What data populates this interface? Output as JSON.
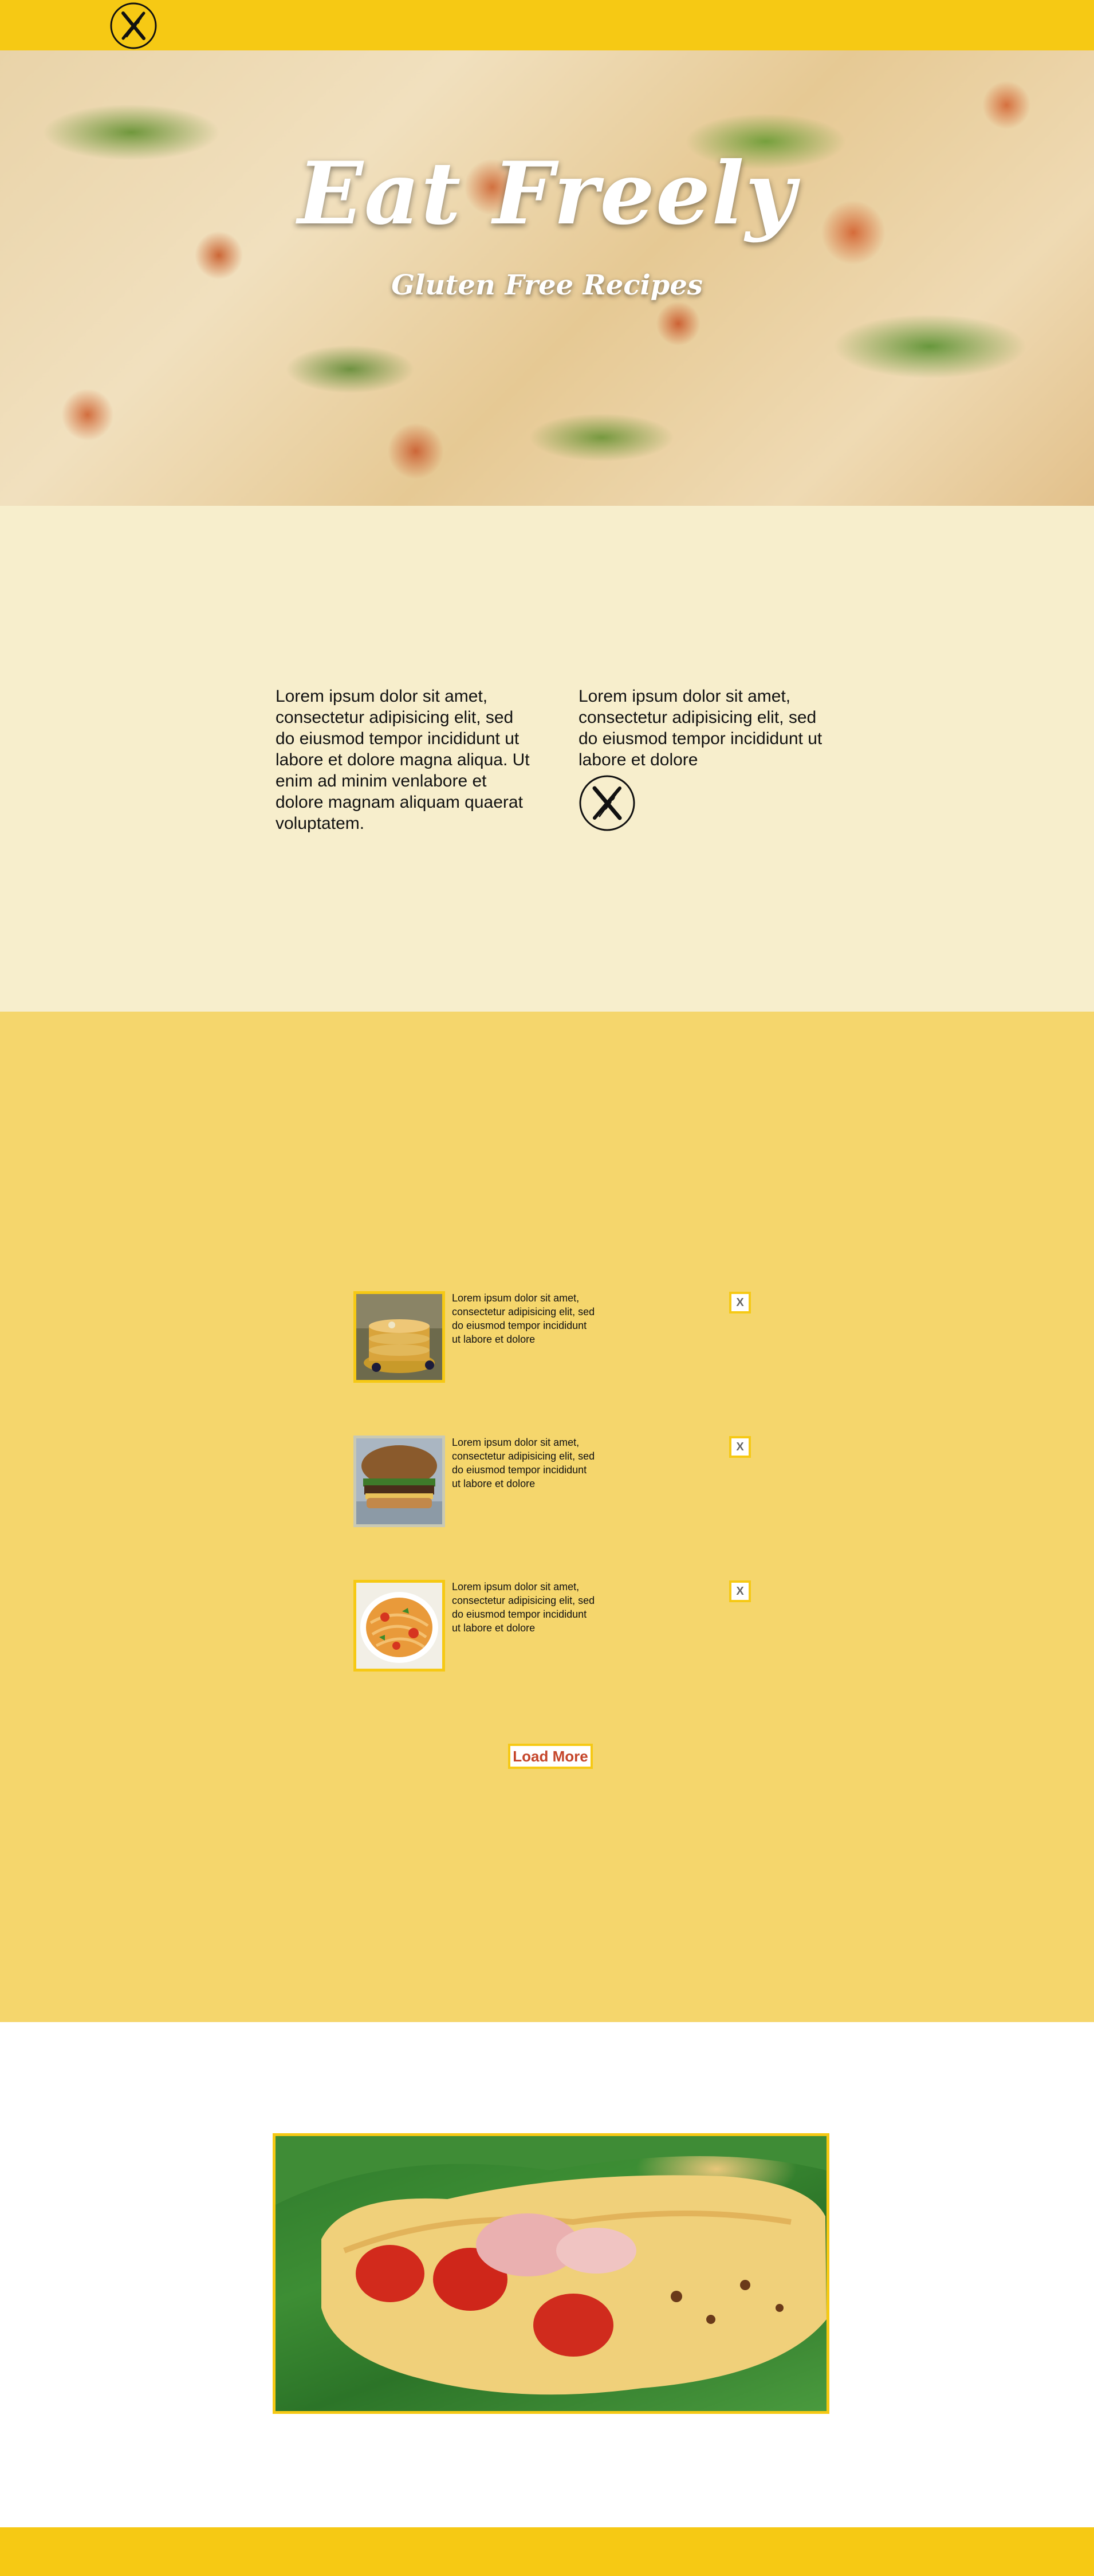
{
  "nav": {
    "logo_icon": "gluten-free-wheat-icon"
  },
  "hero": {
    "title": "Eat Freely",
    "subtitle": "Gluten Free Recipes"
  },
  "intro": {
    "left_text": "Lorem ipsum dolor sit amet, consectetur adipisicing elit, sed do eiusmod tempor incididunt ut labore et dolore magna aliqua. Ut enim ad minim venlabore et dolore magnam aliquam quaerat voluptatem.",
    "right_text": "Lorem ipsum dolor sit amet, consectetur adipisicing elit, sed do eiusmod tempor incididunt ut labore et dolore",
    "logo_icon": "gluten-free-wheat-icon"
  },
  "recipes": [
    {
      "text": "Lorem ipsum dolor sit amet, consectetur adipisicing elit, sed do eiusmod tempor incididunt ut labore et dolore",
      "close_label": "X",
      "thumb_icon": "pancakes-image"
    },
    {
      "text": "Lorem ipsum dolor sit amet, consectetur adipisicing elit, sed do eiusmod tempor incididunt ut labore et dolore",
      "close_label": "X",
      "thumb_icon": "burger-image"
    },
    {
      "text": "Lorem ipsum dolor sit amet, consectetur adipisicing elit, sed do eiusmod tempor incididunt ut labore et dolore",
      "close_label": "X",
      "thumb_icon": "pasta-image"
    }
  ],
  "load_more_label": "Load More",
  "colors": {
    "brand_yellow": "#f6c914",
    "cream": "#f7eecc",
    "list_bg": "#f5d66c",
    "button_text": "#c5462b"
  }
}
